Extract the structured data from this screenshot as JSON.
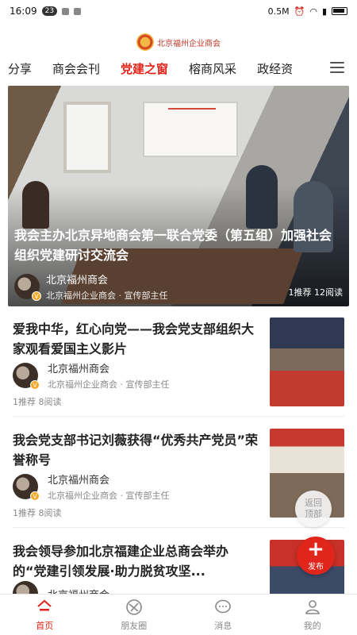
{
  "status_bar": {
    "time": "16:09",
    "notification_count": "23",
    "network_speed": "0.5M",
    "battery_icon": "battery-icon"
  },
  "header": {
    "logo_text": "北京福州企业商会"
  },
  "tabs": [
    {
      "label": "分享",
      "active": false
    },
    {
      "label": "商会会刊",
      "active": false
    },
    {
      "label": "党建之窗",
      "active": true
    },
    {
      "label": "榕商风采",
      "active": false
    },
    {
      "label": "政经资",
      "active": false
    }
  ],
  "hero": {
    "title": "我会主办北京异地商会第一联合党委（第五组）加强社会组织党建研讨交流会",
    "author_name": "北京福州商会",
    "author_role": "北京福州企业商会 · 宣传部主任",
    "stats": "1推荐  12阅读"
  },
  "articles": [
    {
      "title": "爱我中华，红心向党——我会党支部组织大家观看爱国主义影片",
      "author_name": "北京福州商会",
      "author_role": "北京福州企业商会 · 宣传部主任",
      "stats": "1推荐  8阅读"
    },
    {
      "title": "我会党支部书记刘薇获得“优秀共产党员”荣誉称号",
      "author_name": "北京福州商会",
      "author_role": "北京福州企业商会 · 宣传部主任",
      "stats": "1推荐  8阅读"
    },
    {
      "title": "我会领导参加北京福建企业总商会举办的“党建引领发展·助力脱贫攻坚...",
      "author_name": "北京福州商会",
      "author_role": "",
      "stats": ""
    }
  ],
  "floating": {
    "back_top_line1": "返回",
    "back_top_line2": "顶部",
    "publish_label": "发布"
  },
  "bottom_nav": [
    {
      "label": "首页",
      "icon": "home-icon",
      "active": true
    },
    {
      "label": "朋友圈",
      "icon": "moments-icon",
      "active": false
    },
    {
      "label": "消息",
      "icon": "message-icon",
      "active": false
    },
    {
      "label": "我的",
      "icon": "profile-icon",
      "active": false
    }
  ],
  "colors": {
    "accent": "#e1251b",
    "text": "#222222",
    "muted": "#888888"
  }
}
